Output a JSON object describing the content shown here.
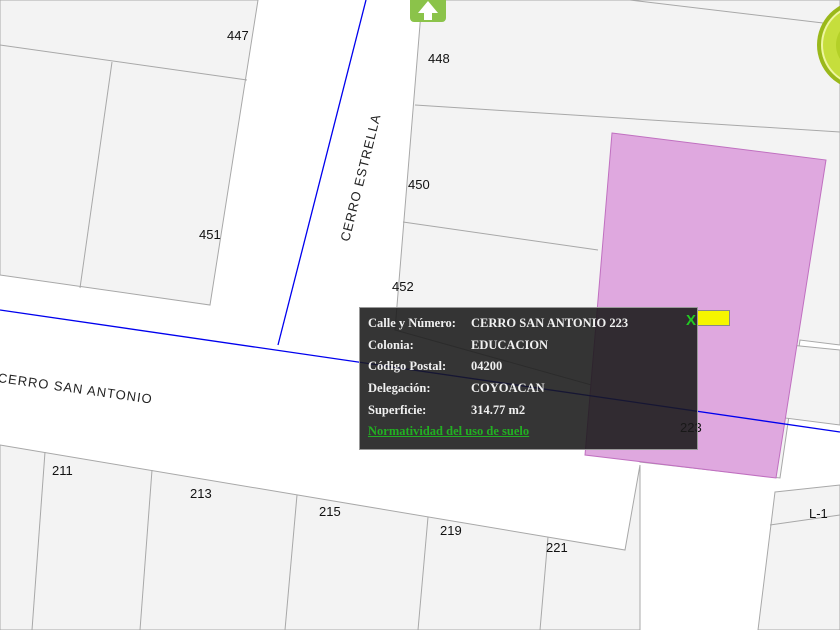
{
  "map": {
    "lot_numbers": [
      "447",
      "448",
      "450",
      "451",
      "452",
      "223",
      "211",
      "213",
      "215",
      "219",
      "221",
      "L-1"
    ],
    "streets": [
      "CERRO ESTRELLA",
      "CERRO SAN ANTONIO"
    ],
    "highlight_color": "#dfa8df",
    "street_line_color": "#0000ee"
  },
  "popup": {
    "rows": [
      {
        "key": "Calle y Número:",
        "value": "CERRO SAN ANTONIO 223"
      },
      {
        "key": "Colonia:",
        "value": "EDUCACION"
      },
      {
        "key": "Código Postal:",
        "value": "04200"
      },
      {
        "key": "Delegación:",
        "value": "COYOACAN"
      },
      {
        "key": "Superficie:",
        "value": "314.77 m2"
      }
    ],
    "link": "Normatividad del uso de suelo",
    "close": "X"
  },
  "controls": {
    "north_icon": "north-arrow-icon",
    "compass_icon": "compass-icon"
  }
}
